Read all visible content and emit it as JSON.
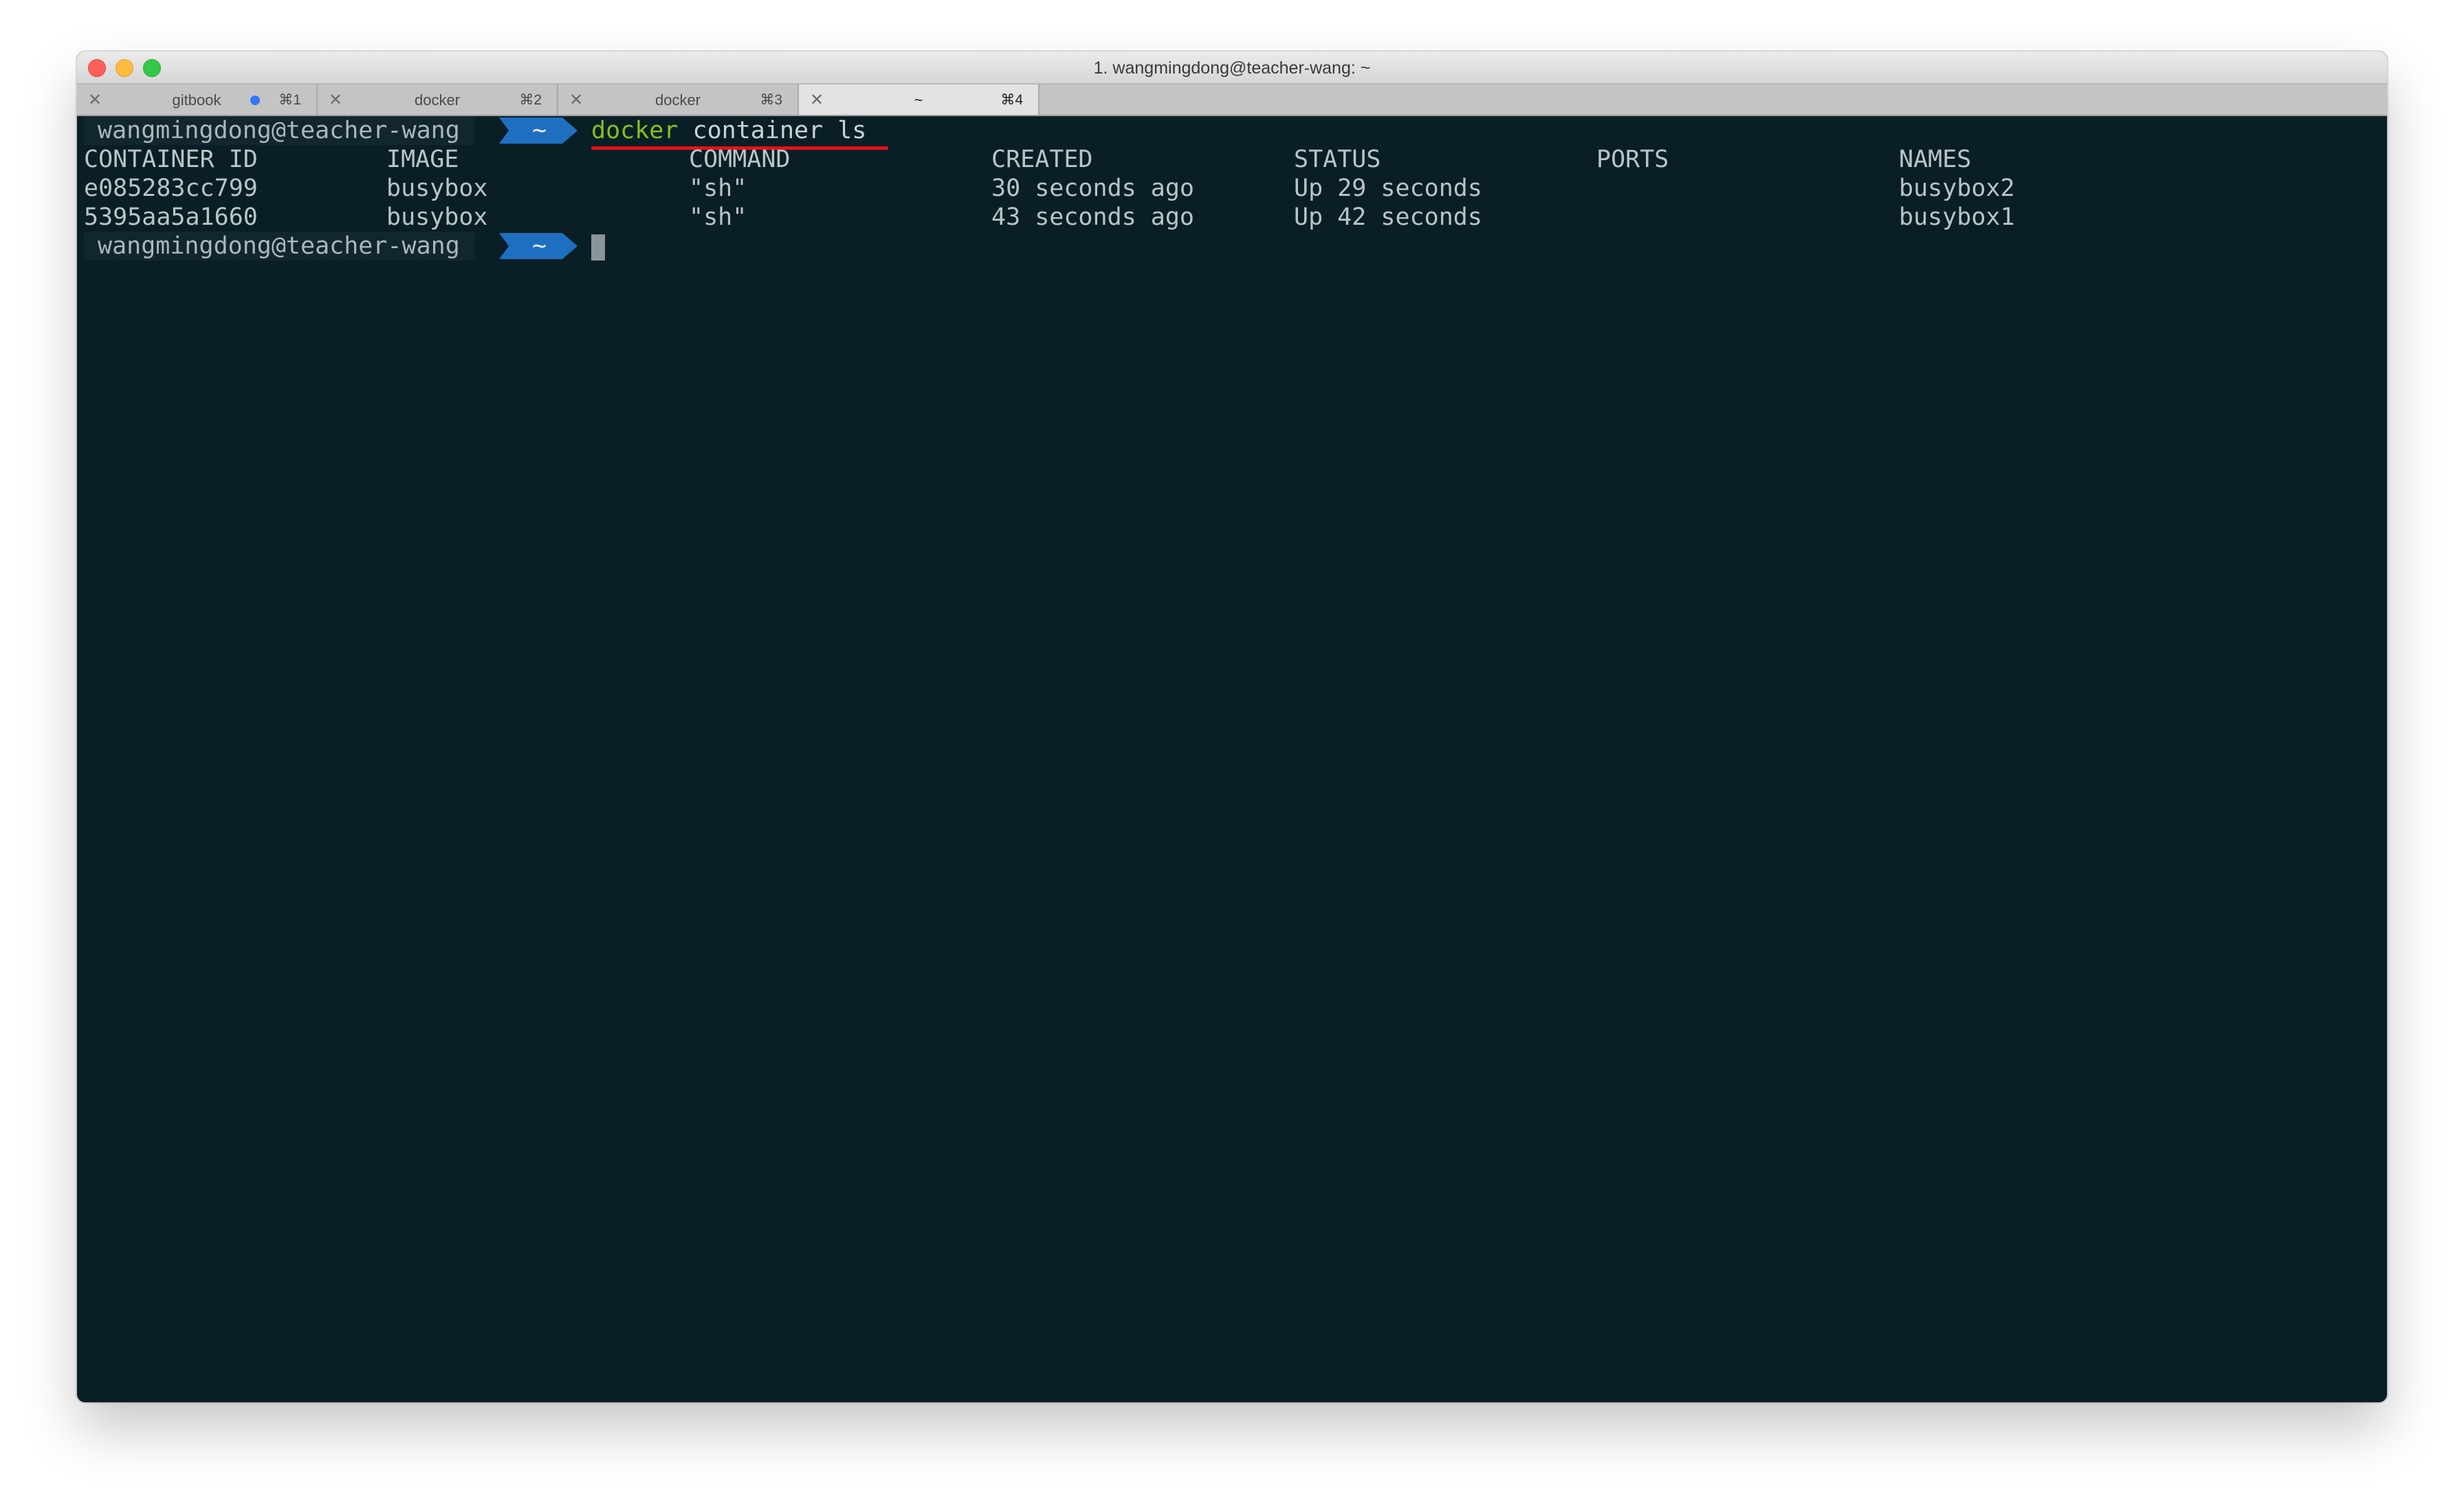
{
  "window": {
    "title": "1. wangmingdong@teacher-wang: ~"
  },
  "tabs": [
    {
      "label": "gitbook",
      "shortcut": "⌘1",
      "close": "✕",
      "dot": true
    },
    {
      "label": "docker",
      "shortcut": "⌘2",
      "close": "✕",
      "dot": false
    },
    {
      "label": "docker",
      "shortcut": "⌘3",
      "close": "✕",
      "dot": false
    },
    {
      "label": "~",
      "shortcut": "⌘4",
      "close": "✕",
      "dot": false
    }
  ],
  "prompt": {
    "user": "wangmingdong@teacher-wang",
    "dir": "~"
  },
  "command": {
    "keyword": "docker",
    "rest": " container ls"
  },
  "table": {
    "headers": [
      "CONTAINER ID",
      "IMAGE",
      "COMMAND",
      "CREATED",
      "STATUS",
      "PORTS",
      "NAMES"
    ],
    "rows": [
      [
        "e085283cc799",
        "busybox",
        "\"sh\"",
        "30 seconds ago",
        "Up 29 seconds",
        "",
        "busybox2"
      ],
      [
        "5395aa5a1660",
        "busybox",
        "\"sh\"",
        "43 seconds ago",
        "Up 42 seconds",
        "",
        "busybox1"
      ]
    ]
  },
  "colors": {
    "terminal_bg": "#0a1e26",
    "prompt_arrow": "#1f6fc1",
    "keyword": "#8cbd1c",
    "underline": "#e3131a"
  }
}
